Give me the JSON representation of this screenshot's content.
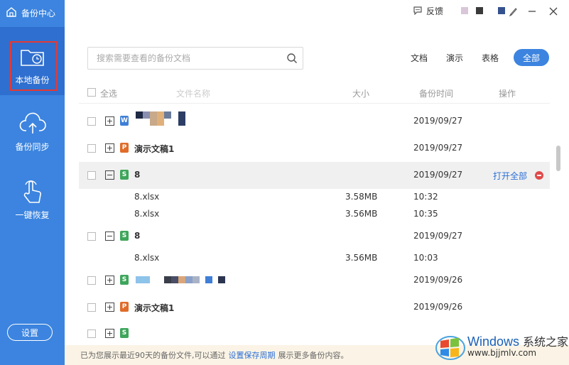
{
  "sidebar": {
    "brand": "备份中心",
    "items": [
      {
        "label": "本地备份",
        "active": true,
        "icon": "local-backup-folder-icon"
      },
      {
        "label": "备份同步",
        "active": false,
        "icon": "cloud-upload-icon"
      },
      {
        "label": "一键恢复",
        "active": false,
        "icon": "touch-hand-icon"
      }
    ],
    "settings_label": "设置",
    "bg_color": "#3c84df"
  },
  "titlebar": {
    "feedback_label": "反馈",
    "controls": [
      "skin-icon",
      "minimize-icon",
      "close-icon"
    ]
  },
  "search": {
    "placeholder": "搜索需要查看的备份文档",
    "value": ""
  },
  "filters": {
    "tabs": [
      "文档",
      "演示",
      "表格",
      "全部"
    ],
    "active": "全部"
  },
  "table": {
    "headers": {
      "select_all": "全选",
      "name": "文件名称",
      "size": "大小",
      "time": "备份时间",
      "action": "操作"
    },
    "rows": [
      {
        "name": "",
        "date": "2019/09/27",
        "type": "word",
        "expanded": false
      },
      {
        "name": "演示文稿1",
        "date": "2019/09/27",
        "type": "ppt",
        "expanded": false
      },
      {
        "name": "8",
        "date": "2019/09/27",
        "type": "excel",
        "expanded": true,
        "action": "打开全部",
        "children": [
          {
            "name": "8.xlsx",
            "size": "3.58MB",
            "time": "10:32"
          },
          {
            "name": "8.xlsx",
            "size": "3.56MB",
            "time": "10:35"
          }
        ]
      },
      {
        "name": "8",
        "date": "2019/09/27",
        "type": "excel",
        "expanded": true,
        "children": [
          {
            "name": "8.xlsx",
            "size": "3.56MB",
            "time": "10:03"
          }
        ]
      },
      {
        "name": "",
        "date": "2019/09/26",
        "type": "excel",
        "expanded": false
      },
      {
        "name": "演示文稿1",
        "date": "2019/09/26",
        "type": "ppt",
        "expanded": false
      }
    ]
  },
  "footer": {
    "text_before": "已为您展示最近90天的备份文件,可以通过",
    "link": "设置保存周期",
    "text_after": "展示更多备份内容。"
  },
  "watermark": {
    "title": "Windows",
    "title_cn": "系统之家",
    "url": "www.bjjmlv.com"
  },
  "colors": {
    "accent": "#3c84df",
    "word": "#3f7fd7",
    "ppt": "#e06c2b",
    "excel": "#3ea65b",
    "delete": "#e04a4a",
    "link": "#2b6fd6"
  }
}
